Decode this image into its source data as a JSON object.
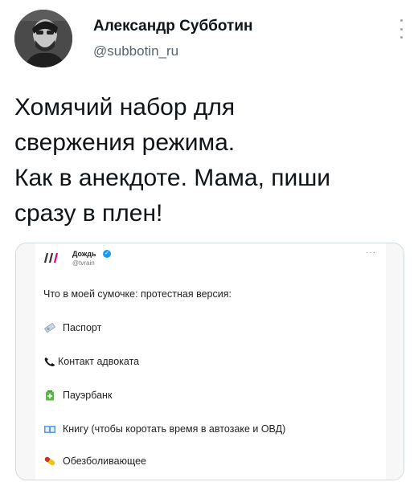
{
  "author": {
    "name": "Александр Субботин",
    "handle": "@subbotin_ru"
  },
  "tweet": {
    "lines": [
      "Хомячий набор для",
      "свержения режима.",
      "Как в анекдоте. Мама, пиши",
      "сразу в плен!"
    ]
  },
  "embedded_tweet": {
    "account_name": "Дождь",
    "account_handle": "@tvrain",
    "title": "Что в моей сумочке: протестная версия:",
    "items": [
      {
        "label": "Паспорт",
        "icon": "passport-icon"
      },
      {
        "label": "Контакт адвоката",
        "icon": "phone-icon"
      },
      {
        "label": "Пауэрбанк",
        "icon": "battery-icon"
      },
      {
        "label": "Книгу (чтобы коротать время в автозаке и ОВД)",
        "icon": "book-icon"
      },
      {
        "label": "Обезболивающее",
        "icon": "pill-icon"
      }
    ]
  },
  "colors": {
    "text": "#0f1419",
    "secondary": "#536471",
    "verified": "#1d9bf0",
    "rain_brand": "#e2007a"
  }
}
